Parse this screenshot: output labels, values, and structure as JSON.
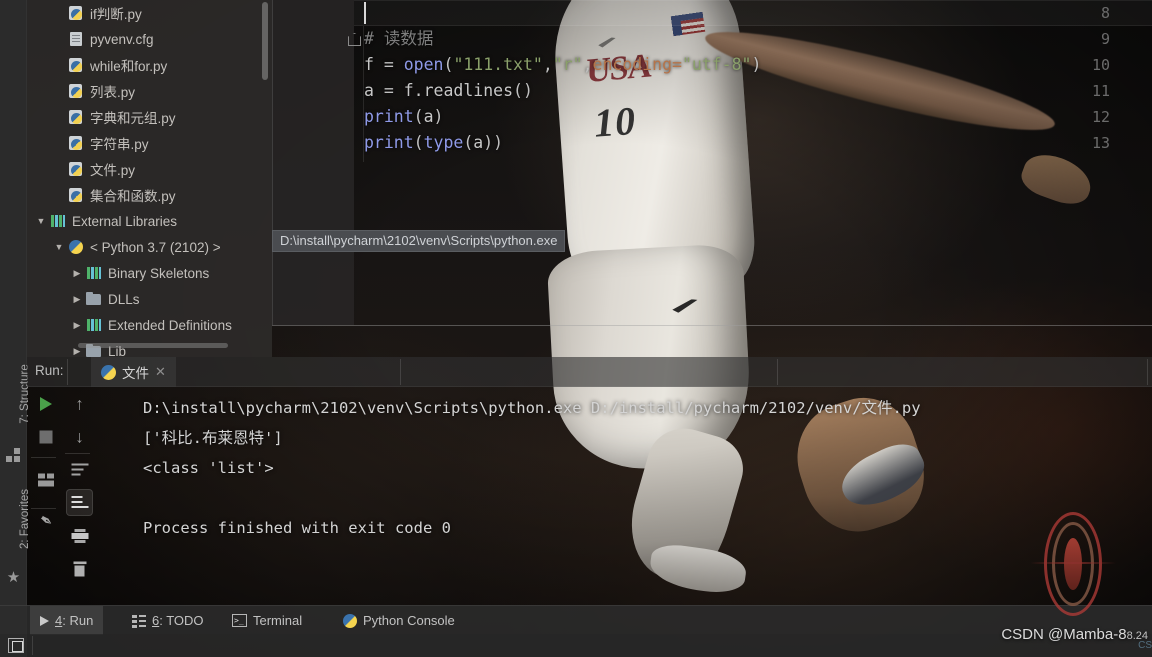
{
  "project_tree": {
    "name": "project-tree",
    "items": [
      {
        "label": "if判断.py",
        "icon": "python-file-icon",
        "indent": 1,
        "arrow": "",
        "type": "py"
      },
      {
        "label": "pyvenv.cfg",
        "icon": "config-file-icon",
        "indent": 1,
        "arrow": "",
        "type": "cfg"
      },
      {
        "label": "while和for.py",
        "icon": "python-file-icon",
        "indent": 1,
        "arrow": "",
        "type": "py"
      },
      {
        "label": "列表.py",
        "icon": "python-file-icon",
        "indent": 1,
        "arrow": "",
        "type": "py"
      },
      {
        "label": "字典和元组.py",
        "icon": "python-file-icon",
        "indent": 1,
        "arrow": "",
        "type": "py"
      },
      {
        "label": "字符串.py",
        "icon": "python-file-icon",
        "indent": 1,
        "arrow": "",
        "type": "py"
      },
      {
        "label": "文件.py",
        "icon": "python-file-icon",
        "indent": 1,
        "arrow": "",
        "type": "py"
      },
      {
        "label": "集合和函数.py",
        "icon": "python-file-icon",
        "indent": 1,
        "arrow": "",
        "type": "py"
      },
      {
        "label": "External Libraries",
        "icon": "library-bars-icon",
        "indent": 0,
        "arrow": "▼",
        "type": "bars"
      },
      {
        "label": "< Python 3.7 (2102) >",
        "icon": "python-interpreter-icon",
        "indent": 1,
        "arrow": "▼",
        "type": "pysnake"
      },
      {
        "label": "Binary Skeletons",
        "icon": "library-bars-icon",
        "indent": 2,
        "arrow": "▶",
        "type": "bars"
      },
      {
        "label": "DLLs",
        "icon": "folder-icon",
        "indent": 2,
        "arrow": "▶",
        "type": "folder"
      },
      {
        "label": "Extended Definitions",
        "icon": "library-bars-icon",
        "indent": 2,
        "arrow": "▶",
        "type": "bars"
      },
      {
        "label": "Lib",
        "icon": "folder-icon",
        "indent": 2,
        "arrow": "▶",
        "type": "folder"
      }
    ],
    "tooltip": "D:\\install\\pycharm\\2102\\venv\\Scripts\\python.exe"
  },
  "editor": {
    "name": "code-editor",
    "line_numbers": [
      "8",
      "9",
      "10",
      "11",
      "12",
      "13"
    ],
    "lines": [
      {
        "num": "8",
        "tokens": []
      },
      {
        "num": "9",
        "fold": true,
        "tokens": [
          {
            "t": "comment",
            "s": "# 读数据"
          }
        ]
      },
      {
        "num": "10",
        "tokens": [
          {
            "t": "default",
            "s": "f "
          },
          {
            "t": "punc",
            "s": "= "
          },
          {
            "t": "func",
            "s": "open"
          },
          {
            "t": "punc",
            "s": "("
          },
          {
            "t": "string",
            "s": "\"111.txt\""
          },
          {
            "t": "punc",
            "s": ","
          },
          {
            "t": "string",
            "s": "\"r\""
          },
          {
            "t": "punc",
            "s": ","
          },
          {
            "t": "kwarg",
            "s": "encoding="
          },
          {
            "t": "string",
            "s": "\"utf-8\""
          },
          {
            "t": "punc",
            "s": ")"
          }
        ]
      },
      {
        "num": "11",
        "tokens": [
          {
            "t": "default",
            "s": "a "
          },
          {
            "t": "punc",
            "s": "= "
          },
          {
            "t": "default",
            "s": "f."
          },
          {
            "t": "default",
            "s": "readlines"
          },
          {
            "t": "punc",
            "s": "()"
          }
        ]
      },
      {
        "num": "12",
        "tokens": [
          {
            "t": "func",
            "s": "print"
          },
          {
            "t": "punc",
            "s": "("
          },
          {
            "t": "default",
            "s": "a"
          },
          {
            "t": "punc",
            "s": ")"
          }
        ]
      },
      {
        "num": "13",
        "tokens": [
          {
            "t": "func",
            "s": "print"
          },
          {
            "t": "punc",
            "s": "("
          },
          {
            "t": "func",
            "s": "type"
          },
          {
            "t": "punc",
            "s": "("
          },
          {
            "t": "default",
            "s": "a"
          },
          {
            "t": "punc",
            "s": "))"
          }
        ]
      }
    ]
  },
  "left_rail": {
    "structure_label": "7: Structure",
    "structure_num": "7",
    "favorites_label": "2: Favorites",
    "favorites_num": "2"
  },
  "run_window": {
    "run_label": "Run:",
    "tab": {
      "label": "文件",
      "close": "✕",
      "icon": "python-icon"
    },
    "toolbar": [
      {
        "name": "rerun-button",
        "glyph": "play-icon",
        "selected": false
      },
      {
        "name": "stop-button",
        "glyph": "stop-icon",
        "selected": false
      },
      {
        "name": "layout-button",
        "glyph": "layout-icon",
        "selected": false
      },
      {
        "name": "pin-tab-button",
        "glyph": "pin-icon",
        "selected": false
      },
      {
        "name": "up-stack-button",
        "glyph": "arrow-up-icon",
        "selected": false
      },
      {
        "name": "down-stack-button",
        "glyph": "arrow-down-icon",
        "selected": false
      },
      {
        "name": "soft-wrap-button",
        "glyph": "wrap-icon",
        "selected": false
      },
      {
        "name": "scroll-to-end-button",
        "glyph": "scroll-end-icon",
        "selected": true
      },
      {
        "name": "print-button",
        "glyph": "print-icon",
        "selected": false
      },
      {
        "name": "clear-all-button",
        "glyph": "trash-icon",
        "selected": false
      }
    ],
    "console_lines": [
      "D:\\install\\pycharm\\2102\\venv\\Scripts\\python.exe D:/install/pycharm/2102/venv/文件.py",
      "['科比.布莱恩特']",
      "<class 'list'>",
      "",
      "Process finished with exit code 0"
    ]
  },
  "bottom_bar": {
    "items": [
      {
        "label": "4: Run",
        "num": "4",
        "rest": ": Run",
        "icon": "play-icon",
        "active": true
      },
      {
        "label": "6: TODO",
        "num": "6",
        "rest": ": TODO",
        "icon": "todo-list-icon",
        "active": false
      },
      {
        "label": "Terminal",
        "num": "",
        "rest": "Terminal",
        "icon": "terminal-icon",
        "active": false
      },
      {
        "label": "Python Console",
        "num": "",
        "rest": "Python Console",
        "icon": "python-console-icon",
        "active": false
      }
    ]
  },
  "status_bar": {
    "widget_icon": "toggle-toolwindow-icon"
  },
  "watermark": {
    "text": "CSDN @Mamba-8",
    "tail": "8.24",
    "csdn_small": "CS"
  },
  "colors": {
    "accent_green": "#4aa14a",
    "string": "#8aa06a",
    "keyword_arg": "#b5744a",
    "function": "#8f9ae8",
    "comment": "#7e7e7e",
    "panel_bg": "#2d2b2a",
    "rail_bg": "#2b2b2b"
  }
}
